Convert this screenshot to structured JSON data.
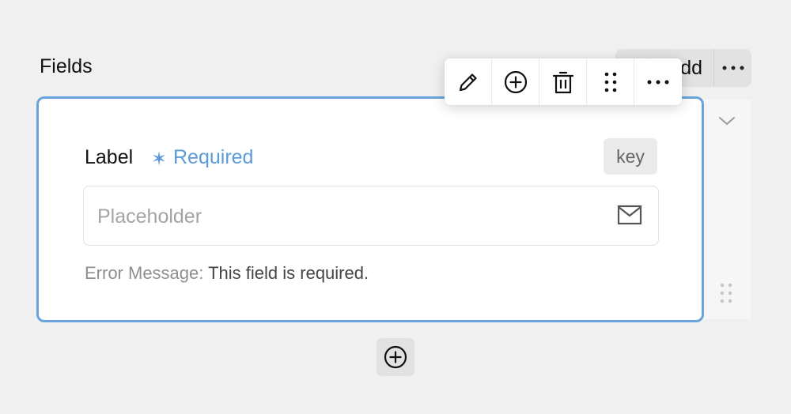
{
  "section": {
    "title": "Fields"
  },
  "header": {
    "add_label": "Add"
  },
  "field": {
    "label": "Label",
    "required_mark": "✶",
    "required_text": "Required",
    "key_badge": "key",
    "input_placeholder": "Placeholder",
    "error_label": "Error Message:",
    "error_text": "This field is required."
  },
  "toolbar": {
    "items": [
      "pencil-icon",
      "plus-circle-icon",
      "trash-icon",
      "drag-handle-icon",
      "more-icon"
    ]
  },
  "colors": {
    "accent": "#69a3df",
    "required": "#5b9bd9",
    "background": "#f0f0f0"
  }
}
